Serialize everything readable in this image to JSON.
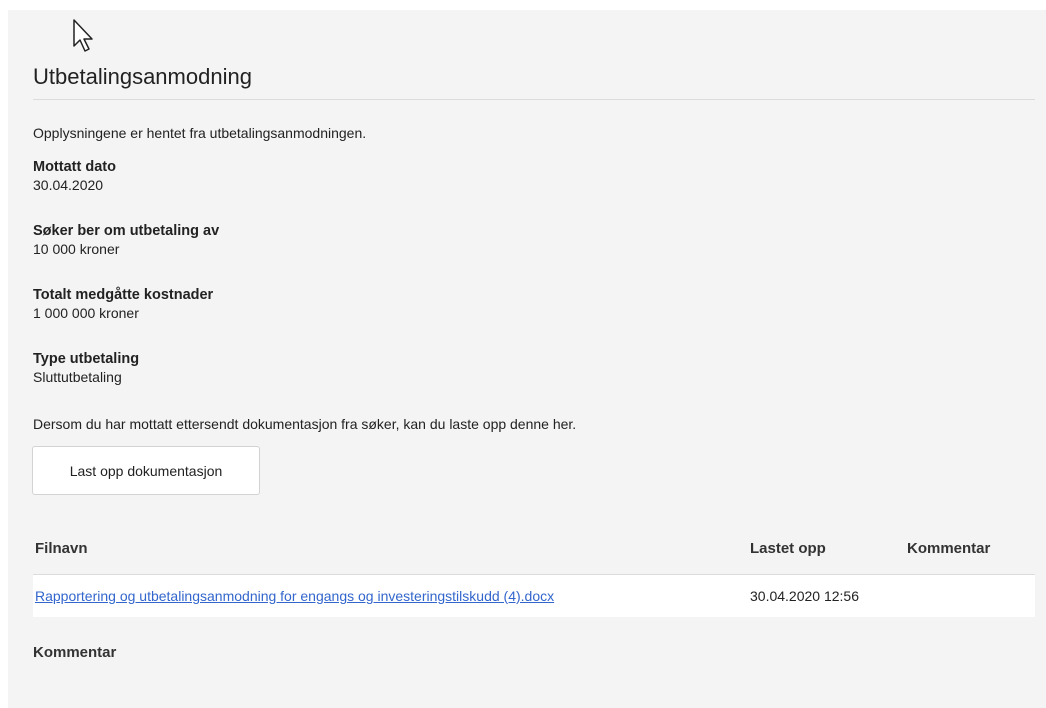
{
  "title": "Utbetalingsanmodning",
  "intro": "Opplysningene er hentet fra utbetalingsanmodningen.",
  "fields": [
    {
      "label": "Mottatt dato",
      "value": "30.04.2020"
    },
    {
      "label": "Søker ber om utbetaling av",
      "value": "10 000 kroner"
    },
    {
      "label": "Totalt medgåtte kostnader",
      "value": "1 000 000 kroner"
    },
    {
      "label": "Type utbetaling",
      "value": "Sluttutbetaling"
    }
  ],
  "upload": {
    "hint": "Dersom du har mottatt ettersendt dokumentasjon fra søker, kan du laste opp denne her.",
    "button_label": "Last opp dokumentasjon"
  },
  "files_table": {
    "headers": {
      "name": "Filnavn",
      "uploaded": "Lastet opp",
      "comment": "Kommentar"
    },
    "rows": [
      {
        "name": "Rapportering og utbetalingsanmodning for engangs og investeringstilskudd (4).docx",
        "uploaded": "30.04.2020 12:56",
        "comment": ""
      }
    ]
  },
  "comment_section": {
    "heading": "Kommentar"
  },
  "icons": {
    "cursor": "mouse-pointer-icon"
  },
  "colors": {
    "link": "#3366cc",
    "panel_background": "#f4f4f4"
  }
}
